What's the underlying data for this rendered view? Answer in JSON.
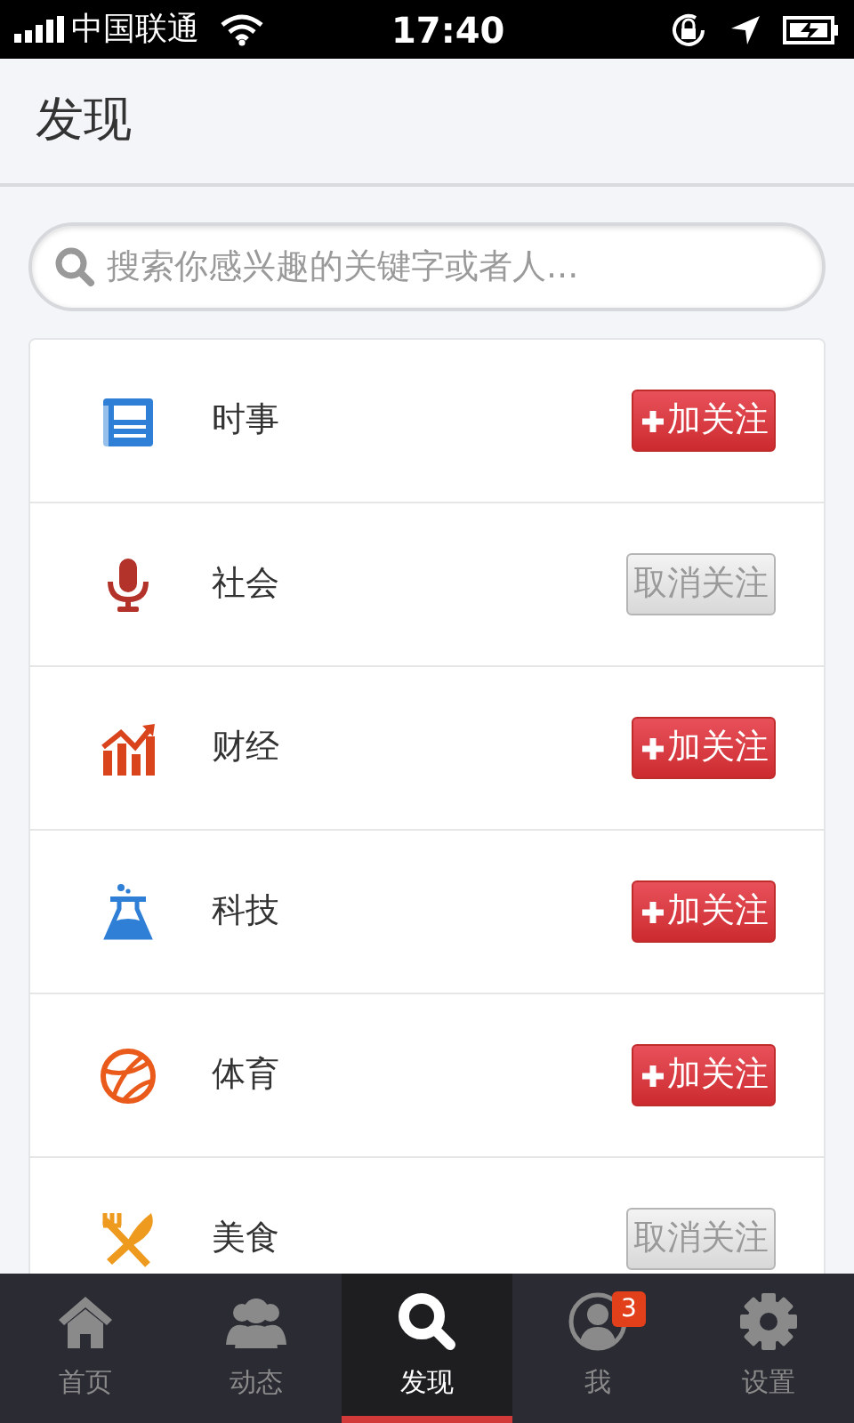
{
  "status_bar": {
    "carrier": "中国联通",
    "time": "17:40"
  },
  "header": {
    "title": "发现"
  },
  "search": {
    "placeholder": "搜索你感兴趣的关键字或者人..."
  },
  "topics": [
    {
      "kind": "news",
      "name": "时事",
      "followed": false,
      "button": "加关注"
    },
    {
      "kind": "mic",
      "name": "社会",
      "followed": true,
      "button": "取消关注"
    },
    {
      "kind": "chart",
      "name": "财经",
      "followed": false,
      "button": "加关注"
    },
    {
      "kind": "flask",
      "name": "科技",
      "followed": false,
      "button": "加关注"
    },
    {
      "kind": "ball",
      "name": "体育",
      "followed": false,
      "button": "加关注"
    },
    {
      "kind": "food",
      "name": "美食",
      "followed": true,
      "button": "取消关注"
    }
  ],
  "tab_bar": [
    {
      "kind": "home",
      "label": "首页",
      "selected": false
    },
    {
      "kind": "people",
      "label": "动态",
      "selected": false
    },
    {
      "kind": "search",
      "label": "发现",
      "selected": true
    },
    {
      "kind": "me",
      "label": "我",
      "selected": false,
      "badge": "3"
    },
    {
      "kind": "gear",
      "label": "设置",
      "selected": false
    }
  ]
}
